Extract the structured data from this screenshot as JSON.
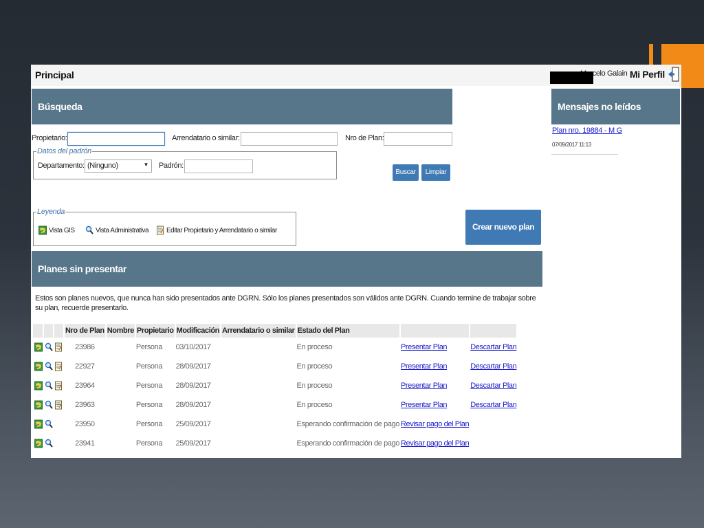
{
  "header": {
    "title": "Principal",
    "user_name": "Marcelo Galain",
    "profile_label": "Mi Perfil"
  },
  "busqueda": {
    "title": "Búsqueda",
    "propietario_label": "Propietario:",
    "propietario_value": "",
    "arrendatario_label": "Arrendatario o similar:",
    "arrendatario_value": "",
    "nro_plan_label": "Nro de Plan:",
    "nro_plan_value": "",
    "padron_legend": "Datos del padrón",
    "departamento_label": "Departamento:",
    "departamento_selected": "(Ninguno)",
    "padron_label": "Padrón:",
    "padron_value": "",
    "buscar_label": "Buscar",
    "limpiar_label": "Limpiar"
  },
  "leyenda": {
    "legend": "Leyenda",
    "items": [
      {
        "label": "Vista GIS",
        "icon": "map-icon"
      },
      {
        "label": "Vista Administrativa",
        "icon": "magnifier-icon"
      },
      {
        "label": "Editar Propietario y Arrendatario o similar",
        "icon": "edit-icon"
      }
    ]
  },
  "crear_plan_label": "Crear nuevo plan",
  "mensajes": {
    "title": "Mensajes no leídos",
    "items": [
      {
        "link": "Plan nro. 19884 - M G",
        "date": "07/09/2017 11:13"
      }
    ]
  },
  "planes": {
    "title": "Planes sin presentar",
    "description": "Estos son planes nuevos, que nunca han sido presentados ante DGRN. Sólo los planes presentados son válidos ante DGRN. Cuando termine de trabajar sobre su plan, recuerde presentarlo.",
    "columns": [
      "Nro de Plan",
      "Nombre",
      "Propietario",
      "Modificación",
      "Arrendatario o similar",
      "Estado del Plan"
    ],
    "rows": [
      {
        "nro": "23986",
        "propietario": "Persona",
        "modificacion": "03/10/2017",
        "estado": "En proceso",
        "action1": "Presentar Plan",
        "action2": "Descartar Plan",
        "editable": true
      },
      {
        "nro": "22927",
        "propietario": "Persona",
        "modificacion": "28/09/2017",
        "estado": "En proceso",
        "action1": "Presentar Plan",
        "action2": "Descartar Plan",
        "editable": true
      },
      {
        "nro": "23964",
        "propietario": "Persona",
        "modificacion": "28/09/2017",
        "estado": "En proceso",
        "action1": "Presentar Plan",
        "action2": "Descartar Plan",
        "editable": true
      },
      {
        "nro": "23963",
        "propietario": "Persona",
        "modificacion": "28/09/2017",
        "estado": "En proceso",
        "action1": "Presentar Plan",
        "action2": "Descartar Plan",
        "editable": true
      },
      {
        "nro": "23950",
        "propietario": "Persona",
        "modificacion": "25/09/2017",
        "estado": "Esperando confirmación de pago",
        "action1": "Revisar pago del Plan",
        "action2": "",
        "editable": false
      },
      {
        "nro": "23941",
        "propietario": "Persona",
        "modificacion": "25/09/2017",
        "estado": "Esperando confirmación de pago",
        "action1": "Revisar pago del Plan",
        "action2": "",
        "editable": false
      }
    ]
  },
  "colors": {
    "panel_header": "#58768a",
    "button": "#3f7ab5",
    "accent": "#f28a18",
    "link": "#1a1acc"
  }
}
